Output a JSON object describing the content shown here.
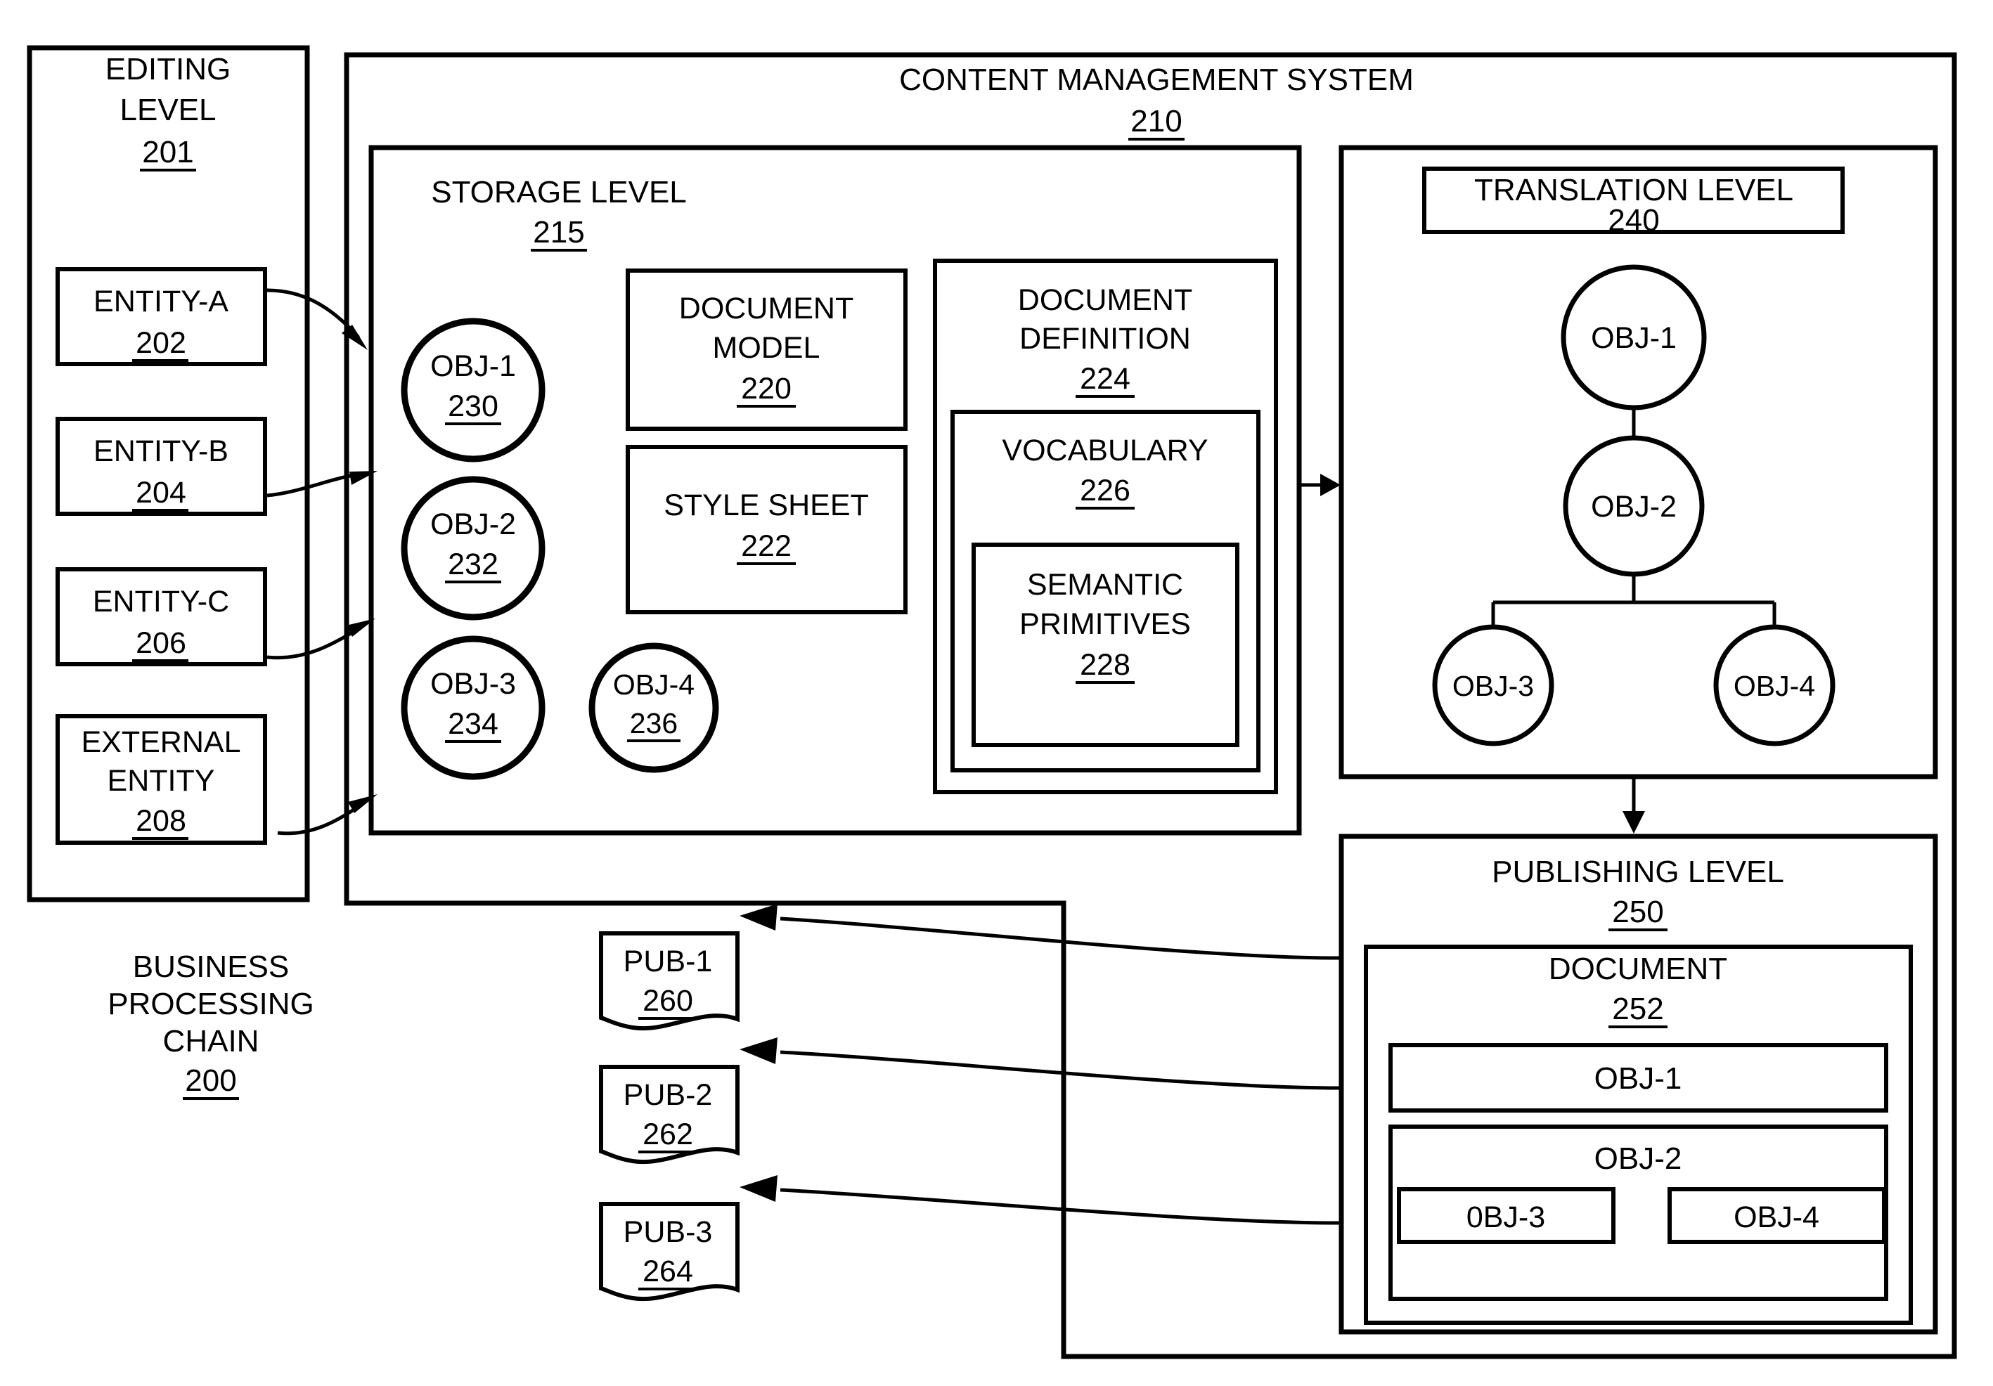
{
  "figure": {
    "kind": "patent-block-diagram",
    "ink_color": "#000000",
    "background_color": "#ffffff"
  },
  "business_chain": {
    "caption_line1": "BUSINESS",
    "caption_line2": "PROCESSING",
    "caption_line3": "CHAIN",
    "ref": "200"
  },
  "editing_level": {
    "title_line1": "EDITING",
    "title_line2": "LEVEL",
    "ref": "201",
    "entities": [
      {
        "label": "ENTITY-A",
        "ref": "202"
      },
      {
        "label": "ENTITY-B",
        "ref": "204"
      },
      {
        "label": "ENTITY-C",
        "ref": "206"
      },
      {
        "label_line1": "EXTERNAL",
        "label_line2": "ENTITY",
        "ref": "208"
      }
    ]
  },
  "cms": {
    "title": "CONTENT MANAGEMENT SYSTEM",
    "ref": "210"
  },
  "storage_level": {
    "title": "STORAGE LEVEL",
    "ref": "215",
    "objects": [
      {
        "label": "OBJ-1",
        "ref": "230"
      },
      {
        "label": "OBJ-2",
        "ref": "232"
      },
      {
        "label": "OBJ-3",
        "ref": "234"
      },
      {
        "label": "OBJ-4",
        "ref": "236"
      }
    ],
    "document_model": {
      "line1": "DOCUMENT",
      "line2": "MODEL",
      "ref": "220"
    },
    "style_sheet": {
      "line1": "STYLE SHEET",
      "ref": "222"
    },
    "document_definition": {
      "line1": "DOCUMENT",
      "line2": "DEFINITION",
      "ref": "224",
      "vocabulary": {
        "line1": "VOCABULARY",
        "ref": "226",
        "semantic_primitives": {
          "line1": "SEMANTIC",
          "line2": "PRIMITIVES",
          "ref": "228"
        }
      }
    }
  },
  "translation_level": {
    "title": "TRANSLATION LEVEL",
    "ref": "240",
    "tree": {
      "root": "OBJ-1",
      "child": "OBJ-2",
      "grandchildren": [
        "OBJ-3",
        "OBJ-4"
      ]
    }
  },
  "publishing_level": {
    "title": "PUBLISHING LEVEL",
    "ref": "250",
    "document": {
      "title": "DOCUMENT",
      "ref": "252",
      "obj1": "OBJ-1",
      "obj2": "OBJ-2",
      "obj3": "0BJ-3",
      "obj4": "OBJ-4"
    }
  },
  "publications": [
    {
      "label": "PUB-1",
      "ref": "260"
    },
    {
      "label": "PUB-2",
      "ref": "262"
    },
    {
      "label": "PUB-3",
      "ref": "264"
    }
  ]
}
